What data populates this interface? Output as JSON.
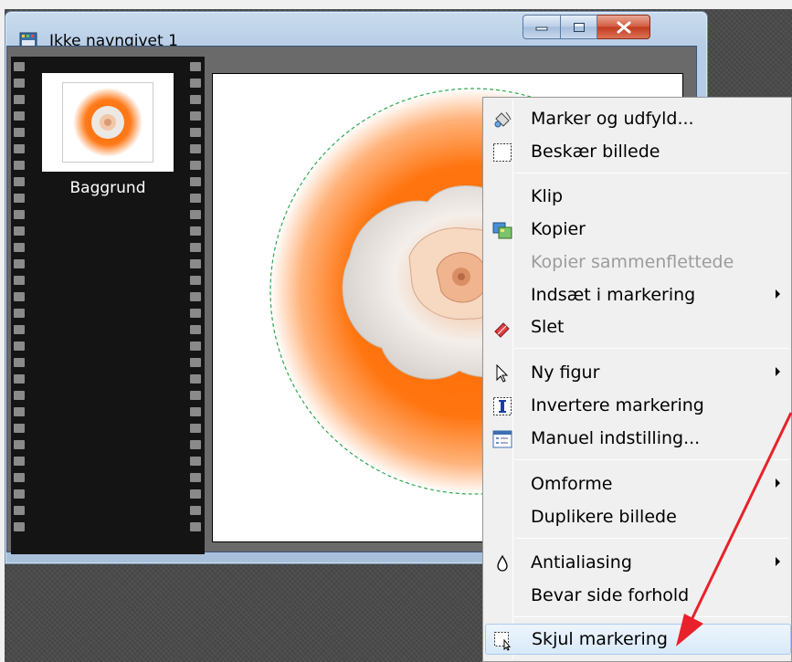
{
  "window": {
    "title": "Ikke navngivet 1"
  },
  "layers": {
    "items": [
      {
        "label": "Baggrund"
      }
    ]
  },
  "context_menu": {
    "items": [
      {
        "label": "Marker og udfyld...",
        "icon": "select-fill-icon",
        "submenu": false,
        "disabled": false
      },
      {
        "label": "Beskær billede",
        "icon": "crop-icon",
        "submenu": false,
        "disabled": false
      },
      {
        "label": "Klip",
        "icon": "",
        "submenu": false,
        "disabled": false
      },
      {
        "label": "Kopier",
        "icon": "copy-image-icon",
        "submenu": false,
        "disabled": false
      },
      {
        "label": "Kopier sammenflettede",
        "icon": "",
        "submenu": false,
        "disabled": true
      },
      {
        "label": "Indsæt i markering",
        "icon": "",
        "submenu": true,
        "disabled": false
      },
      {
        "label": "Slet",
        "icon": "eraser-icon",
        "submenu": false,
        "disabled": false
      },
      {
        "label": "Ny figur",
        "icon": "pointer-icon",
        "submenu": true,
        "disabled": false
      },
      {
        "label": "Invertere markering",
        "icon": "invert-selection-icon",
        "submenu": false,
        "disabled": false
      },
      {
        "label": "Manuel indstilling...",
        "icon": "manual-settings-icon",
        "submenu": false,
        "disabled": false
      },
      {
        "label": "Omforme",
        "icon": "",
        "submenu": true,
        "disabled": false
      },
      {
        "label": "Duplikere billede",
        "icon": "",
        "submenu": false,
        "disabled": false
      },
      {
        "label": "Antialiasing",
        "icon": "droplet-icon",
        "submenu": true,
        "disabled": false
      },
      {
        "label": "Bevar side forhold",
        "icon": "",
        "submenu": false,
        "disabled": false
      },
      {
        "label": "Skjul markering",
        "icon": "hide-selection-icon",
        "submenu": false,
        "disabled": false,
        "highlighted": true
      }
    ]
  },
  "colors": {
    "accent_orange": "#ff6a00",
    "annotation_arrow": "#e8212a",
    "menu_highlight": "#d8e9fa"
  }
}
